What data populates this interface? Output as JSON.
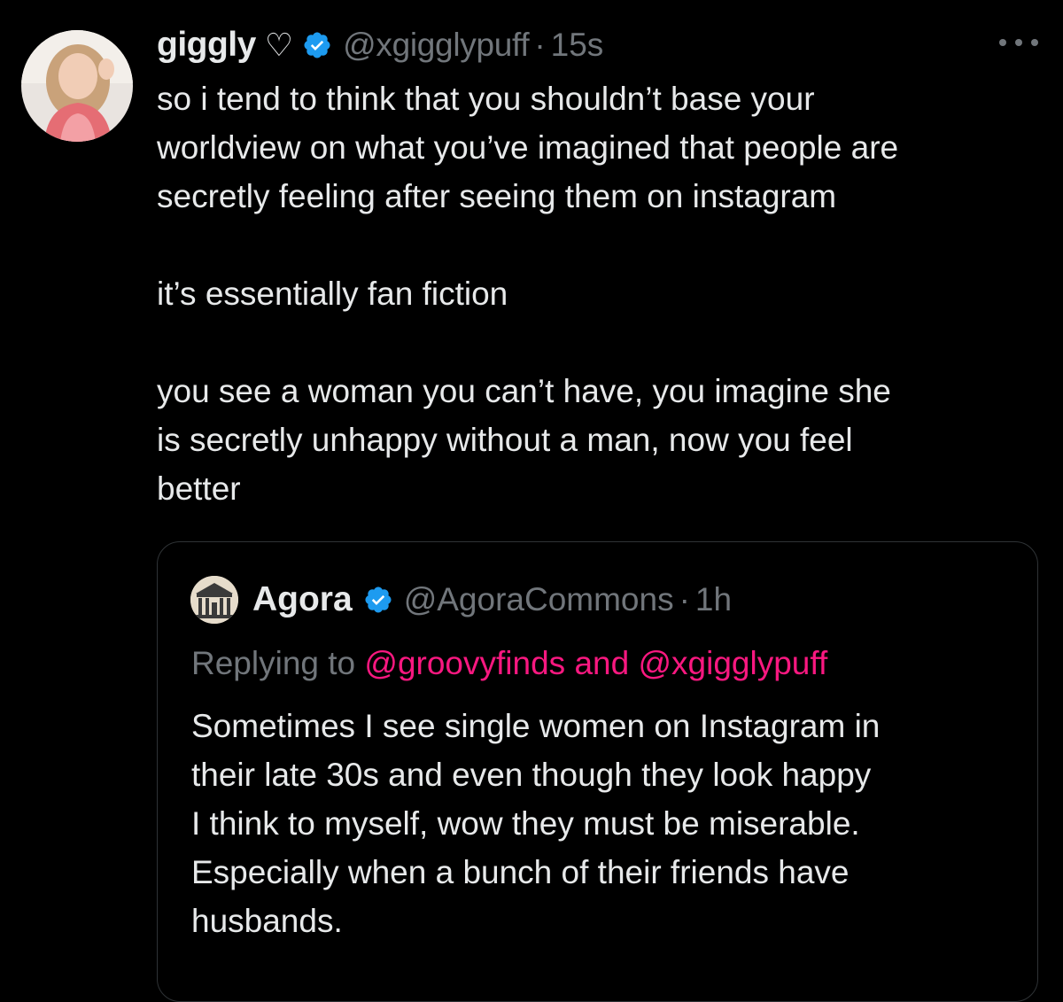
{
  "tweet": {
    "display_name": "giggly",
    "name_decoration": "♡",
    "handle": "@xgigglypuff",
    "separator": "·",
    "time": "15s",
    "body_lines": [
      "so i tend to think that you shouldn’t base your",
      "worldview on what you’ve imagined that people are",
      "secretly feeling after seeing them on instagram"
    ],
    "body_paragraph_2": "it’s essentially fan fiction",
    "body_paragraph_3_lines": [
      "you see a woman you can’t have, you imagine she",
      "is secretly unhappy without a man, now you feel",
      "better"
    ],
    "verified_icon": "verified-badge-icon",
    "more_icon": "more-options-icon"
  },
  "quoted_tweet": {
    "display_name": "Agora",
    "handle": "@AgoraCommons",
    "separator": "·",
    "time": "1h",
    "replying_prefix": "Replying to",
    "reply_mention_1": "@groovyfinds",
    "reply_and": "and",
    "reply_mention_2": "@xgigglypuff",
    "body_lines": [
      "Sometimes I see single women on Instagram in",
      "their late 30s and even though they look happy",
      "I think to myself, wow they must be miserable.",
      "Especially when a bunch of their friends have",
      "husbands."
    ]
  },
  "colors": {
    "background": "#000000",
    "primary_text": "#e7e9ea",
    "secondary_text": "#71767b",
    "mention": "#f91880",
    "verified": "#1d9bf0",
    "border": "#2f3336"
  }
}
